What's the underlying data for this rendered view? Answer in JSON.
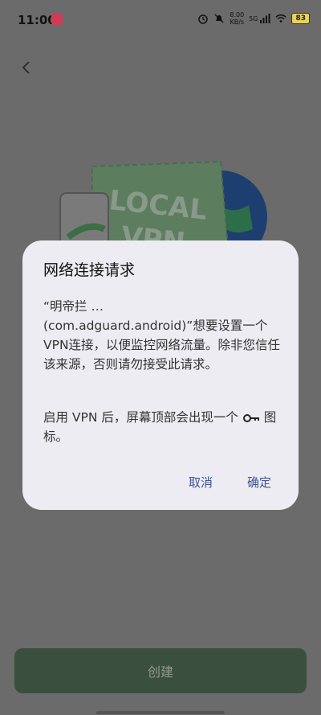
{
  "status_bar": {
    "time": "11:00",
    "net_speed_value": "8.00",
    "net_speed_unit": "KB/s",
    "network_type": "5G",
    "battery": "83"
  },
  "dialog": {
    "title": "网络连接请求",
    "body": "“明帝拦 …\n(com.adguard.android)”想要设置一个VPN连接，以便监控网络流量。除非您信任该来源，否则请勿接受此请求。",
    "body2_prefix": "启用 VPN 后，屏幕顶部会出现一个",
    "body2_suffix": "图标。",
    "cancel_label": "取消",
    "ok_label": "确定"
  },
  "illustration": {
    "text_line1": "LOCAL",
    "text_line2": "VPN"
  },
  "footer": {
    "create_label": "创建"
  },
  "colors": {
    "scrim": "#6b6b6b",
    "dialog_bg": "#edecf2",
    "accent": "#3d5393",
    "create_button": "#3a4f3e"
  }
}
